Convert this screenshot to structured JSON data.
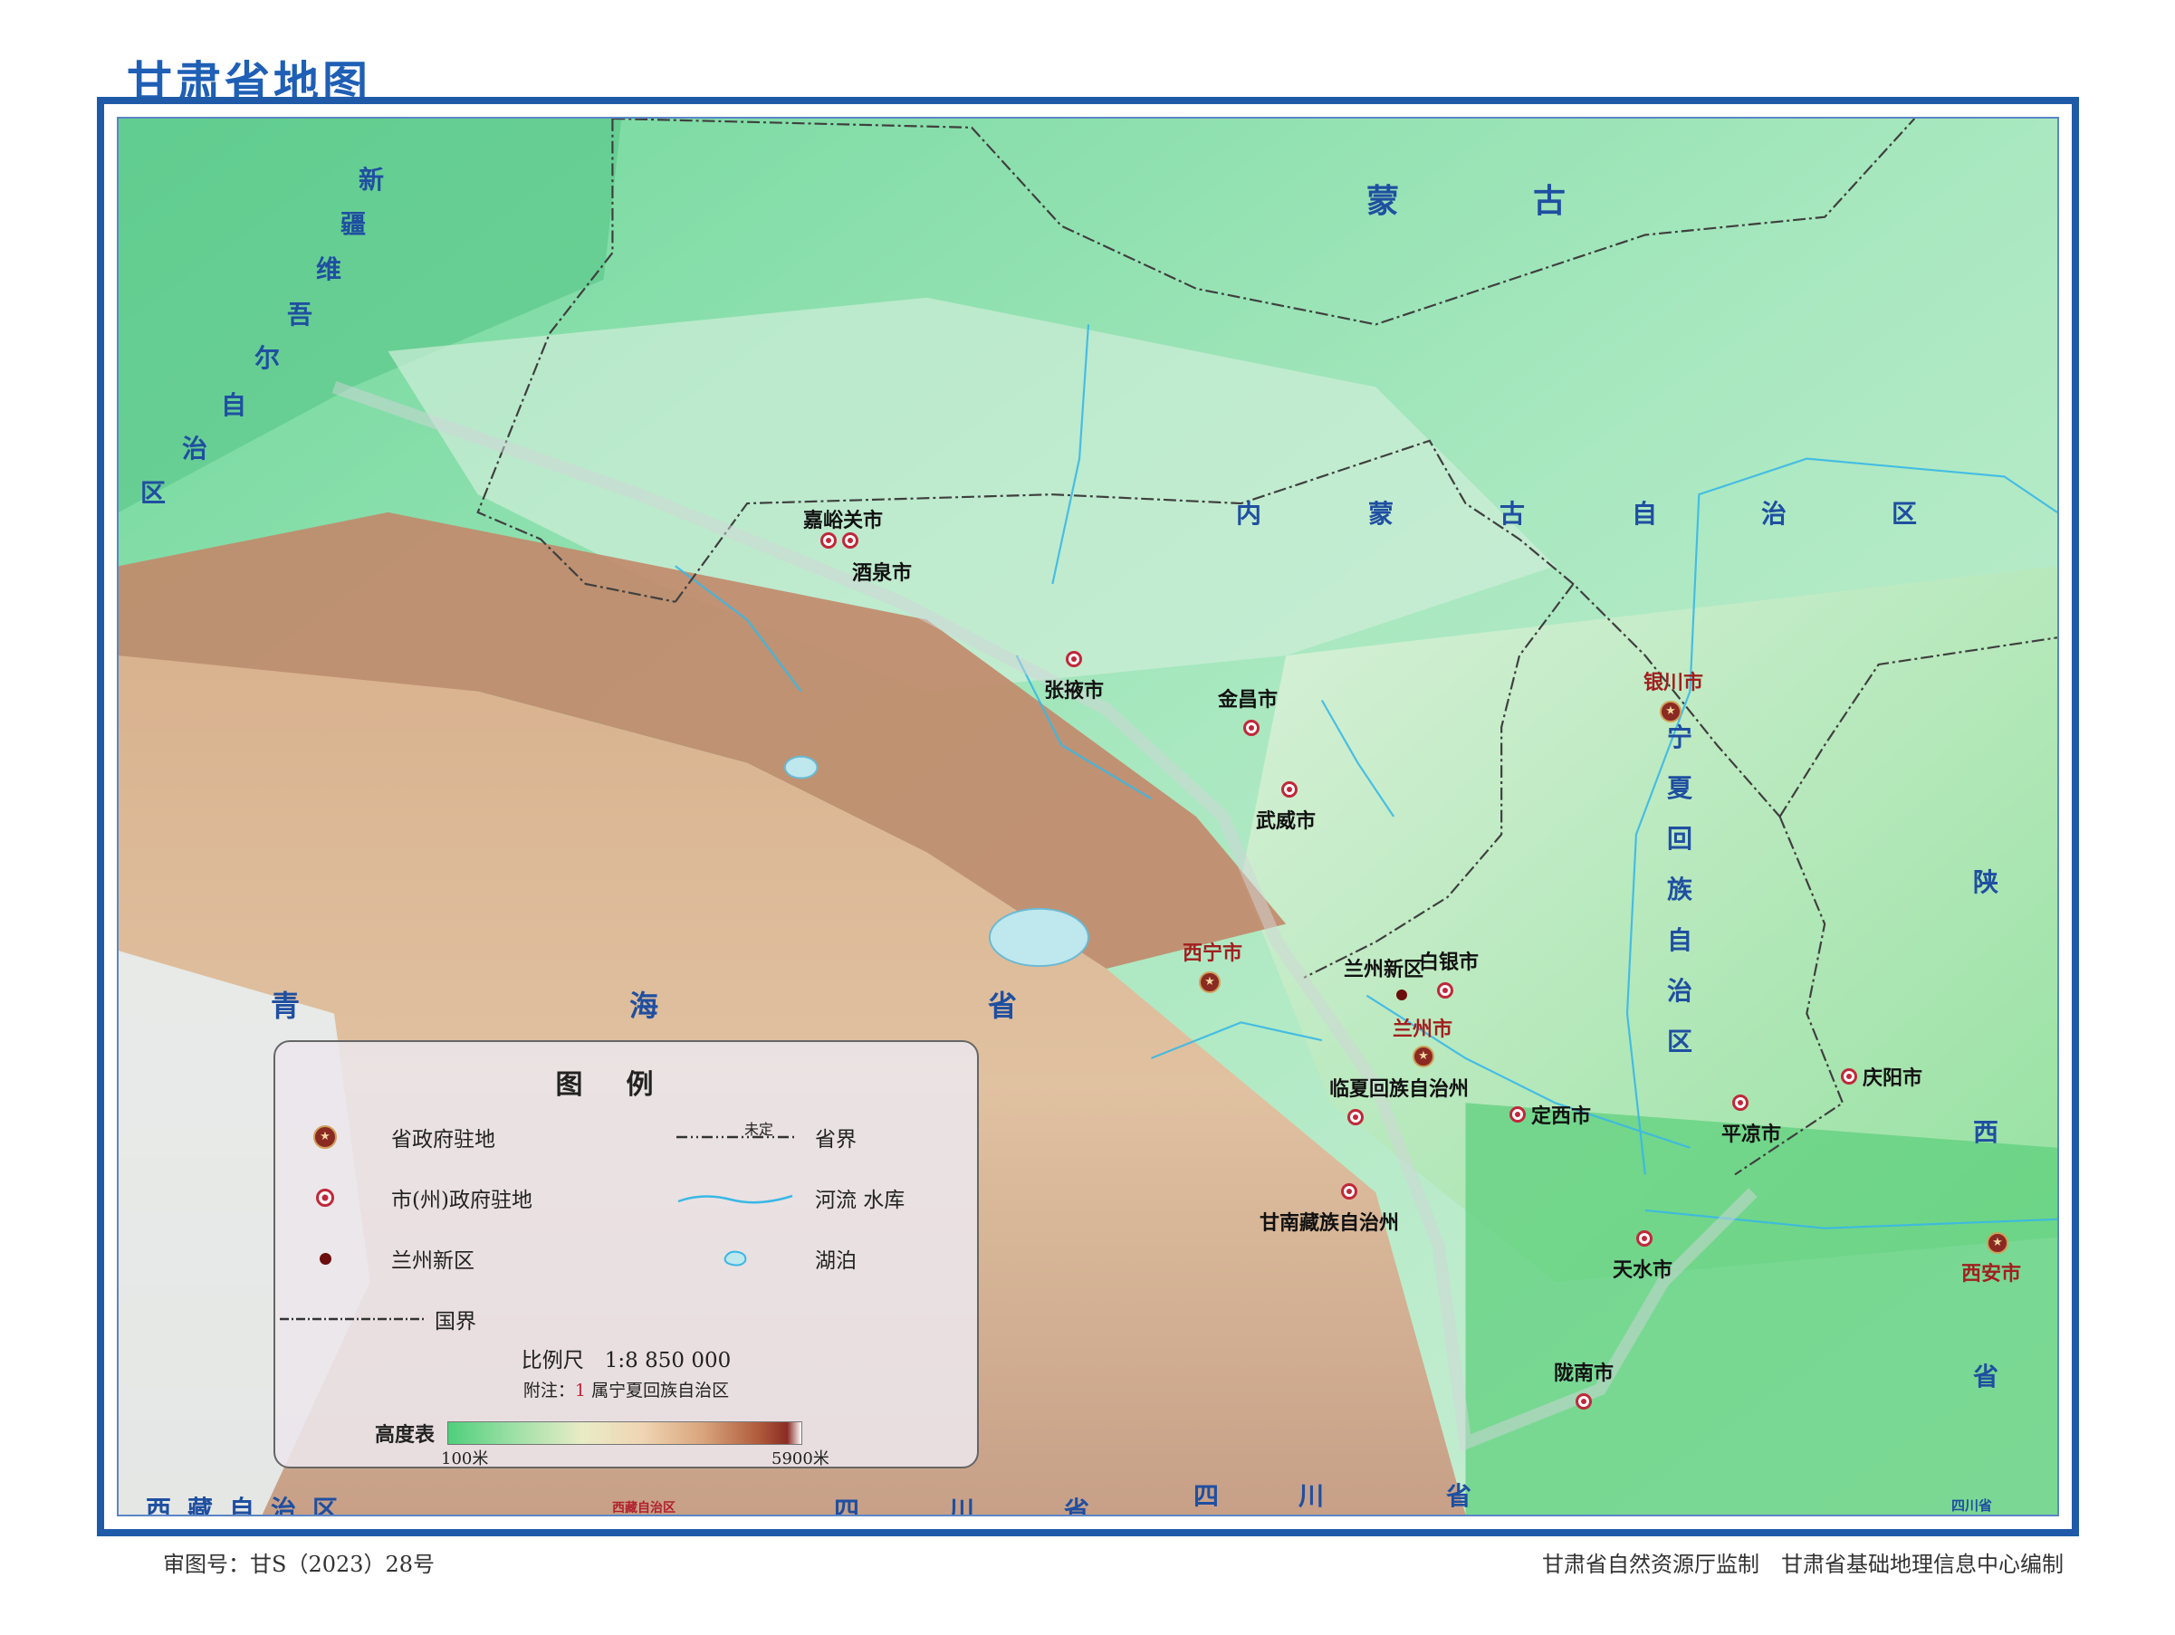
{
  "title": "甘肃省地图",
  "footer": {
    "approval_no": "审图号：甘S（2023）28号",
    "credits": "甘肃省自然资源厅监制　甘肃省基础地理信息中心编制"
  },
  "regions": {
    "xinjiang": [
      "新",
      "疆",
      "维",
      "吾",
      "尔",
      "自",
      "治",
      "区"
    ],
    "mongolia": [
      "蒙",
      "古"
    ],
    "inner_mongolia": [
      "内",
      "蒙",
      "古",
      "自",
      "治",
      "区"
    ],
    "ningxia": [
      "宁",
      "夏",
      "回",
      "族",
      "自",
      "治",
      "区"
    ],
    "qinghai": [
      "青",
      "海",
      "省"
    ],
    "shaanxi": [
      "陕",
      "西",
      "省"
    ],
    "tibet": "西藏自治区",
    "sichuan": [
      "四",
      "川",
      "省"
    ],
    "sichuan_right": [
      "四",
      "川",
      "省"
    ],
    "small_tibet": "西藏自治区",
    "small_sichuan": "四川省"
  },
  "cities": {
    "jiayuguan": "嘉峪关市",
    "jiuquan": "酒泉市",
    "zhangye": "张掖市",
    "jinchang": "金昌市",
    "wuwei": "武威市",
    "yinchuan": "银川市",
    "xining": "西宁市",
    "lanzhou_new": "兰州新区",
    "baiyin": "白银市",
    "lanzhou": "兰州市",
    "linxia": "临夏回族自治州",
    "dingxi": "定西市",
    "pingliang": "平凉市",
    "qingyang": "庆阳市",
    "gannan": "甘南藏族自治州",
    "tianshui": "天水市",
    "xian": "西安市",
    "longnan": "陇南市"
  },
  "legend": {
    "title": "图例",
    "items": {
      "capital": "省政府驻地",
      "prefecture": "市(州)政府驻地",
      "newarea": "兰州新区",
      "national_border": "国界",
      "provincial_border": "省界",
      "undetermined": "未定",
      "river_reservoir": "河流 水库",
      "lake": "湖泊"
    },
    "scale": "比例尺　1:8 850 000",
    "note_prefix": "附注：",
    "note_mark": "1",
    "note_text": "属宁夏回族自治区",
    "elevation_label": "高度表",
    "elevation_min": "100米",
    "elevation_max": "5900米"
  },
  "colors": {
    "frame": "#1e5aa8",
    "title": "#1f5fb5",
    "region_label": "#1f4fa0",
    "city_symbol": "#c0283a",
    "capital_label": "#a11f1f"
  }
}
